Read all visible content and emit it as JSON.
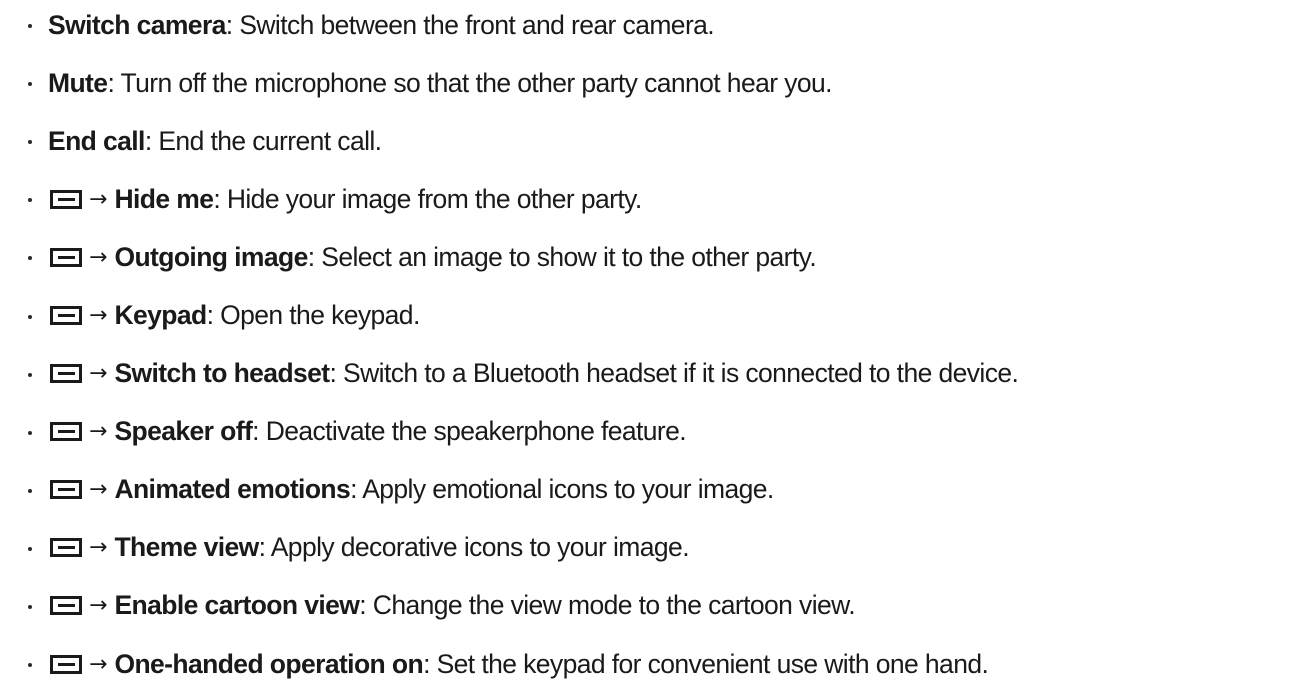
{
  "items": [
    {
      "has_menu": false,
      "term": "Switch camera",
      "desc": ": Switch between the front and rear camera."
    },
    {
      "has_menu": false,
      "term": "Mute",
      "desc": ": Turn off the microphone so that the other party cannot hear you."
    },
    {
      "has_menu": false,
      "term": "End call",
      "desc": ": End the current call."
    },
    {
      "has_menu": true,
      "icon": "menu-key-icon",
      "arrow": "→",
      "term": "Hide me",
      "desc": ": Hide your image from the other party."
    },
    {
      "has_menu": true,
      "icon": "menu-key-icon",
      "arrow": "→",
      "term": "Outgoing image",
      "desc": ": Select an image to show it to the other party."
    },
    {
      "has_menu": true,
      "icon": "menu-key-icon",
      "arrow": "→",
      "term": "Keypad",
      "desc": ": Open the keypad."
    },
    {
      "has_menu": true,
      "icon": "menu-key-icon",
      "arrow": "→",
      "term": "Switch to headset",
      "desc": ": Switch to a Bluetooth headset if it is connected to the device."
    },
    {
      "has_menu": true,
      "icon": "menu-key-icon",
      "arrow": "→",
      "term": "Speaker off",
      "desc": ": Deactivate the speakerphone feature."
    },
    {
      "has_menu": true,
      "icon": "menu-key-icon",
      "arrow": "→",
      "term": "Animated emotions",
      "desc": ": Apply emotional icons to your image."
    },
    {
      "has_menu": true,
      "icon": "menu-key-icon",
      "arrow": "→",
      "term": "Theme view",
      "desc": ": Apply decorative icons to your image."
    },
    {
      "has_menu": true,
      "icon": "menu-key-icon",
      "arrow": "→",
      "term": "Enable cartoon view",
      "desc": ": Change the view mode to the cartoon view."
    },
    {
      "has_menu": true,
      "icon": "menu-key-icon",
      "arrow": "→",
      "term": "One-handed operation on",
      "desc": ": Set the keypad for convenient use with one hand."
    }
  ]
}
